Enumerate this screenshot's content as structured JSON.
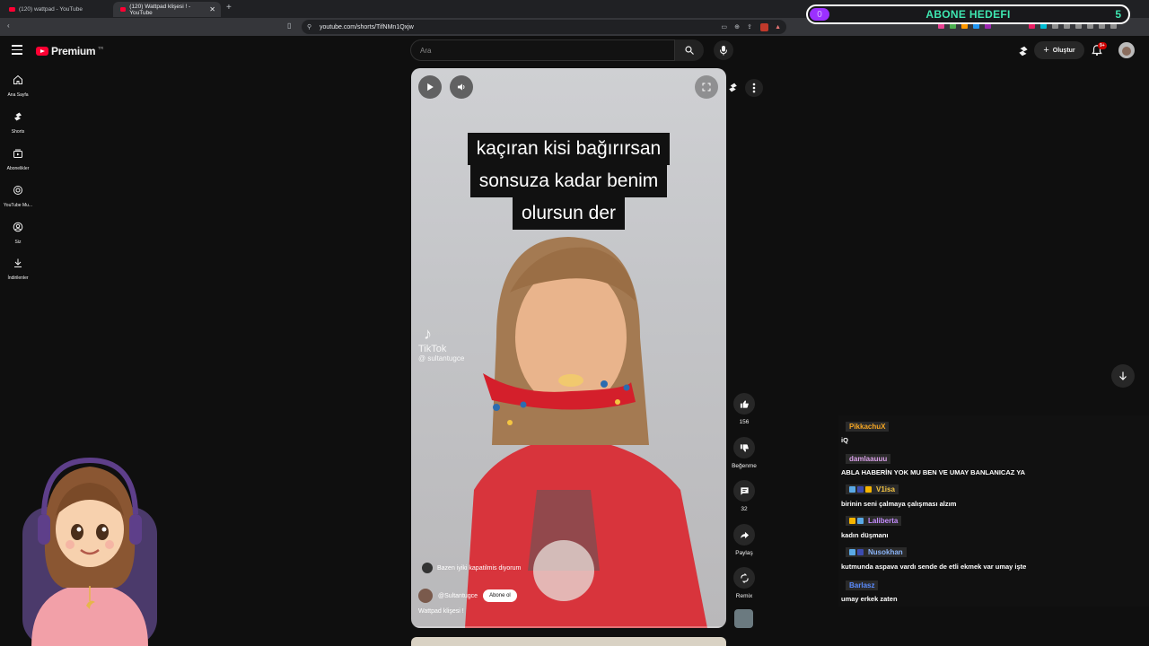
{
  "browser": {
    "tabs": [
      {
        "title": "(120) wattpad - YouTube",
        "active": false
      },
      {
        "title": "(120) Wattpad klişesi ! - YouTube",
        "active": true
      }
    ],
    "new_tab_symbol": "+",
    "url": "youtube.com/shorts/TifNMn1Qxjw",
    "close_symbol": "✕"
  },
  "goal_overlay": {
    "left_value": "0",
    "title": "ABONE HEDEFI",
    "right_value": "5",
    "progress_fraction": 0
  },
  "header": {
    "logo_word": "Premium",
    "logo_country": "TR",
    "search_placeholder": "Ara",
    "create_label": "Oluştur",
    "notifications_badge": "9+"
  },
  "sidebar": {
    "items": [
      {
        "label": "Ana Sayfa",
        "icon": "home-icon"
      },
      {
        "label": "Shorts",
        "icon": "shorts-icon"
      },
      {
        "label": "Abonelikler",
        "icon": "subscriptions-icon"
      },
      {
        "label": "YouTube Mu...",
        "icon": "youtube-music-icon"
      },
      {
        "label": "Siz",
        "icon": "you-icon"
      },
      {
        "label": "İndirilenler",
        "icon": "download-icon"
      }
    ]
  },
  "video": {
    "caption_lines": [
      "kaçıran kisi bağırırsan",
      "sonsuza kadar benim",
      "olursun  der"
    ],
    "watermark_brand": "TikTok",
    "watermark_handle": "@ sultantugce",
    "music_text": "Bazen iyiki kapatilmis diyorum",
    "channel_handle": "@Sultantugce",
    "subscribe_label": "Abone ol",
    "title": "Wattpad klişesi !",
    "progress_fraction": 0.0
  },
  "actions": {
    "like_count": "156",
    "dislike_label": "Beğenme",
    "comment_count": "32",
    "share_label": "Paylaş",
    "remix_label": "Remix"
  },
  "chat": [
    {
      "user": "PikkachuX",
      "color": "#f5a623",
      "text": "iQ",
      "badges": []
    },
    {
      "user": "damlaauuu",
      "color": "#d9a0e8",
      "text": "ABLA HABERİN YOK MU BEN VE UMAY BANLANICAZ YA",
      "badges": []
    },
    {
      "user": "V1isa",
      "color": "#f5c542",
      "text": "birinin seni çalmaya çalışması alzım",
      "badges": [
        "sub",
        "mod",
        "gift"
      ]
    },
    {
      "user": "Laliberta",
      "color": "#c58cff",
      "text": "kadın düşmanı",
      "badges": [
        "gift",
        "sub"
      ]
    },
    {
      "user": "Nusokhan",
      "color": "#8ab4f8",
      "text": "kutmunda aspava vardı sende de etli ekmek var umay işte",
      "badges": [
        "sub",
        "mod"
      ]
    },
    {
      "user": "Barlasz",
      "color": "#5b8cff",
      "text": "umay erkek zaten",
      "badges": []
    }
  ]
}
